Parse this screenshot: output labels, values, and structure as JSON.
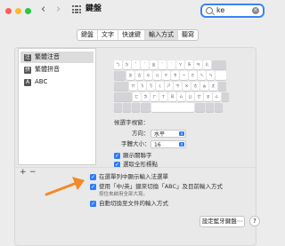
{
  "window": {
    "title": "鍵盤"
  },
  "nav": {
    "back": "‹",
    "forward": "›"
  },
  "search": {
    "value": "ke",
    "clear": "×"
  },
  "tabs": [
    {
      "label": "鍵盤"
    },
    {
      "label": "文字"
    },
    {
      "label": "快速鍵"
    },
    {
      "label": "輸入方式"
    },
    {
      "label": "聽寫"
    }
  ],
  "sources": [
    {
      "icon": "注",
      "label": "繁體注音"
    },
    {
      "icon": "拼",
      "label": "繁體拼音"
    },
    {
      "icon": "A",
      "label": "ABC"
    }
  ],
  "source_controls": {
    "add": "+",
    "remove": "−"
  },
  "keyboard_rows": [
    [
      "ㄅ",
      "ㄉ",
      "ˇ",
      "ˋ",
      "ㄓ",
      "ˊ",
      "˙",
      "ㄚ",
      "ㄞ",
      "ㄢ",
      "ㄦ"
    ],
    [
      "ㄆ",
      "ㄊ",
      "ㄍ",
      "ㄐ",
      "ㄔ",
      "ㄗ",
      "ㄧ",
      "ㄛ",
      "ㄟ",
      "ㄣ"
    ],
    [
      "ㄇ",
      "ㄋ",
      "ㄎ",
      "ㄑ",
      "ㄕ",
      "ㄘ",
      "ㄨ",
      "ㄜ",
      "ㄠ",
      "ㄤ"
    ],
    [
      "ㄈ",
      "ㄌ",
      "ㄏ",
      "ㄒ",
      "ㄖ",
      "ㄙ",
      "ㄩ",
      "ㄝ",
      "ㄡ",
      "ㄥ"
    ]
  ],
  "candidate": {
    "header": "候選字視窗：",
    "direction_label": "方向：",
    "direction_value": "水平",
    "font_size_label": "字體大小：",
    "font_size_value": "16"
  },
  "options_inner": [
    {
      "label": "顯示關聯字",
      "checked": true
    },
    {
      "label": "選取全形標點",
      "checked": true
    }
  ],
  "options_main": [
    {
      "label": "在選單列中顯示輸入法選單",
      "checked": true
    },
    {
      "label": "使用「中/英」鍵來切換「ABC」及目前輸入方式",
      "checked": true
    },
    {
      "label": "自動切換至文件的輸入方式",
      "checked": true
    }
  ],
  "hint": "按住來啟用全部大寫。",
  "footer": {
    "bluetooth_button": "設定藍牙鍵盤⋯",
    "help": "?"
  },
  "colors": {
    "accent": "#2f7cf6",
    "arrow": "#f28a27"
  }
}
